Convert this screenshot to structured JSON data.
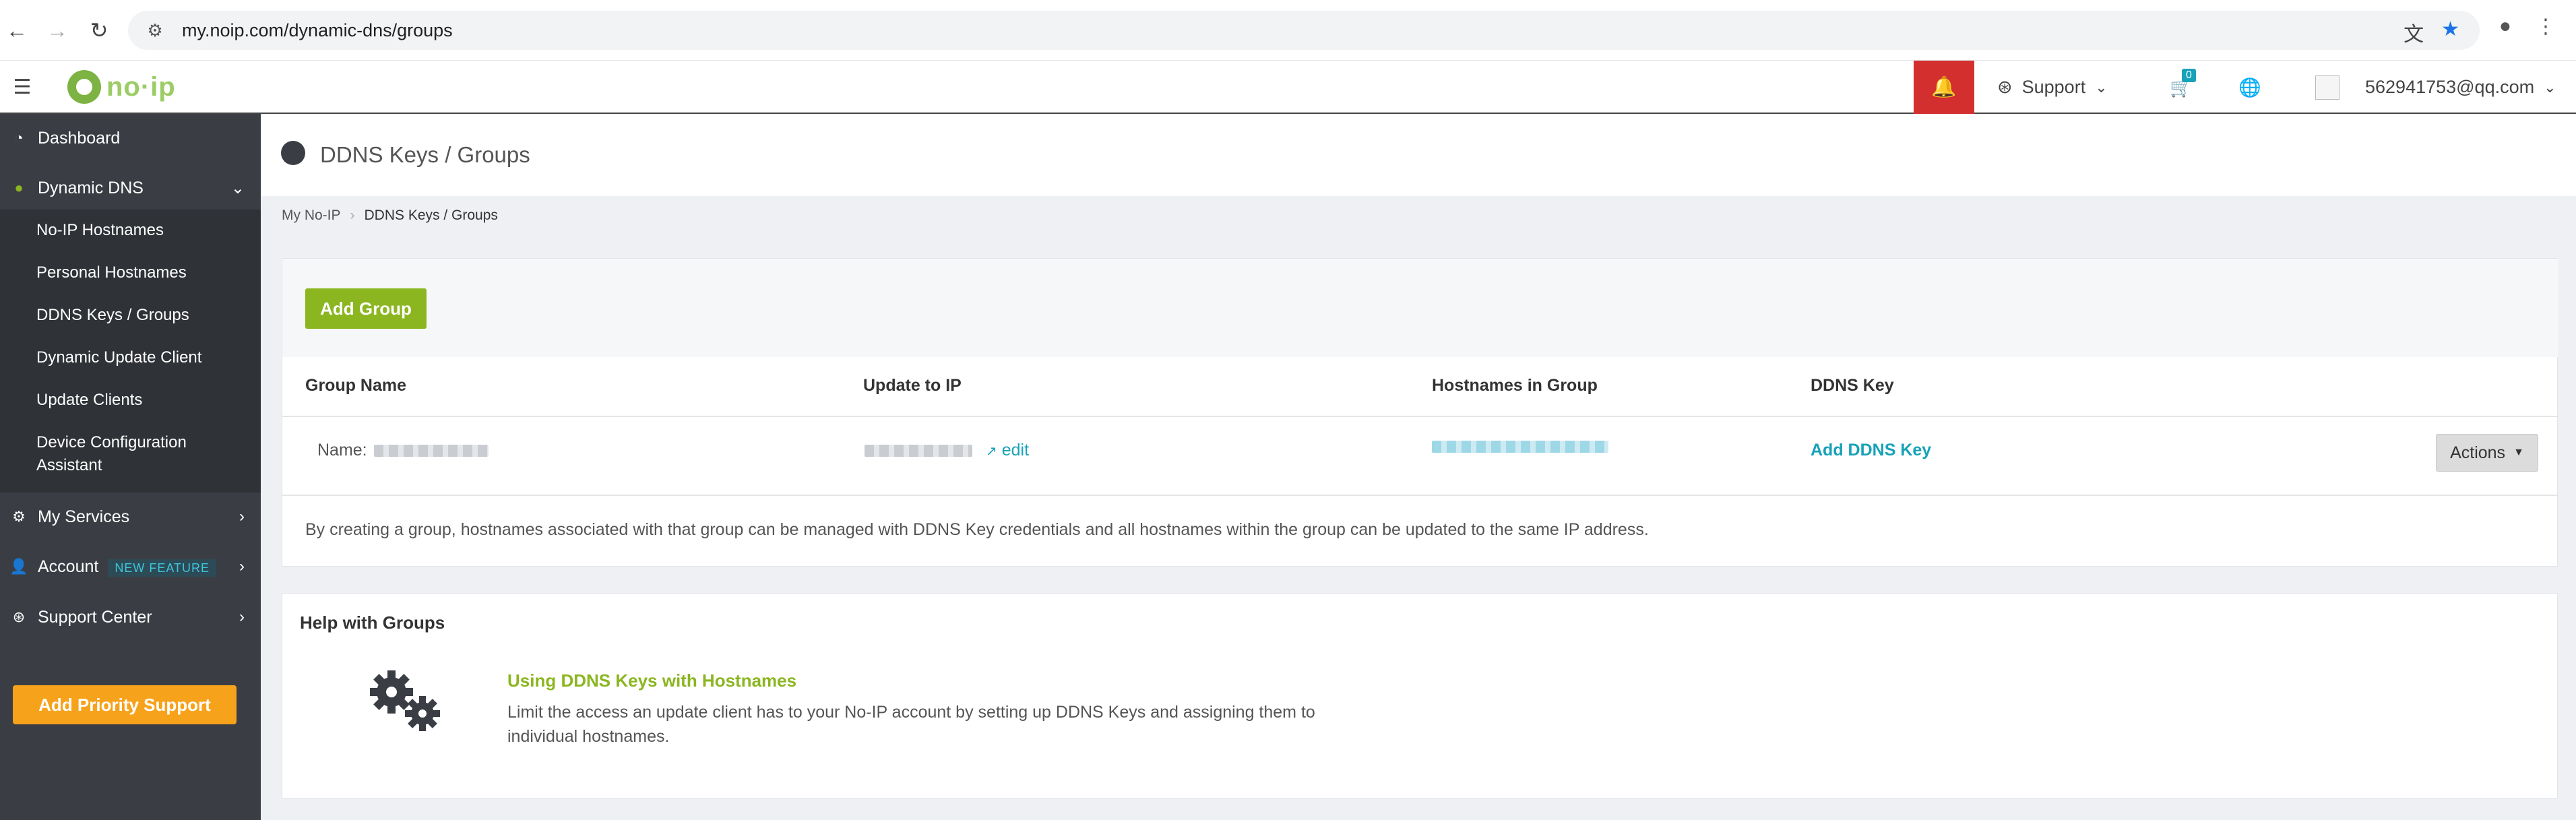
{
  "browser": {
    "url": "my.noip.com/dynamic-dns/groups"
  },
  "header": {
    "logo_text": "no·ip",
    "support_label": "Support",
    "cart_count": "0",
    "user_email": "562941753@qq.com"
  },
  "sidebar": {
    "dashboard": "Dashboard",
    "dynamic_dns": "Dynamic DNS",
    "sub_items": [
      "No-IP Hostnames",
      "Personal Hostnames",
      "DDNS Keys / Groups",
      "Dynamic Update Client",
      "Update Clients",
      "Device Configuration Assistant"
    ],
    "my_services": "My Services",
    "account": "Account",
    "account_badge": "NEW FEATURE",
    "support_center": "Support Center",
    "priority_button": "Add Priority Support"
  },
  "page": {
    "title": "DDNS Keys / Groups",
    "breadcrumb": [
      "My No-IP",
      "DDNS Keys / Groups"
    ]
  },
  "groups": {
    "add_button": "Add Group",
    "columns": [
      "Group Name",
      "Update to IP",
      "Hostnames in Group",
      "DDNS Key"
    ],
    "row": {
      "name_prefix": "Name:",
      "edit_label": "edit",
      "ddns_key_link": "Add DDNS Key",
      "actions_label": "Actions"
    },
    "note": "By creating a group, hostnames associated with that group can be managed with DDNS Key credentials and all hostnames within the group can be updated to the same IP address."
  },
  "help": {
    "title": "Help with Groups",
    "link": "Using DDNS Keys with Hostnames",
    "text": "Limit the access an update client has to your No-IP account by setting up DDNS Keys and assigning them to individual hostnames."
  },
  "colors": {
    "accent_green": "#8bb620",
    "teal": "#17a2b8",
    "sidebar_bg": "#3a3e44",
    "priority_orange": "#f7a21b",
    "bell_red": "#d32f2f"
  }
}
